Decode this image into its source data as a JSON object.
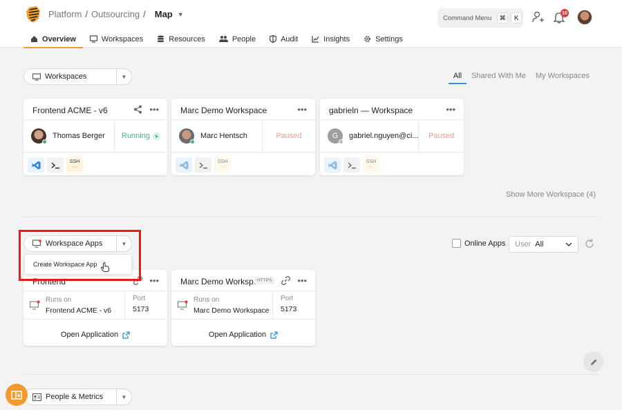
{
  "header": {
    "breadcrumb": [
      "Platform",
      "Outsourcing"
    ],
    "current_page": "Map",
    "command_menu": {
      "label": "Command Menu",
      "key1": "⌘",
      "key2": "K"
    },
    "notification_count": "10"
  },
  "tabs": [
    {
      "label": "Overview",
      "icon": "home-icon",
      "active": true
    },
    {
      "label": "Workspaces",
      "icon": "monitor-icon"
    },
    {
      "label": "Resources",
      "icon": "database-icon"
    },
    {
      "label": "People",
      "icon": "people-icon"
    },
    {
      "label": "Audit",
      "icon": "shield-icon"
    },
    {
      "label": "Insights",
      "icon": "chart-icon"
    },
    {
      "label": "Settings",
      "icon": "gear-icon"
    }
  ],
  "workspaces_section": {
    "selector_label": "Workspaces",
    "filters": [
      "All",
      "Shared With Me",
      "My Workspaces"
    ],
    "active_filter": "All",
    "cards": [
      {
        "title": "Frontend ACME - v6",
        "owner": "Thomas Berger",
        "status": "Running",
        "status_color": "#4caf7d",
        "tools": [
          "vscode-icon",
          "terminal-icon",
          "ssh-icon"
        ]
      },
      {
        "title": "Marc Demo Workspace",
        "owner": "Marc Hentsch",
        "status": "Paused",
        "status_color": "#f0a090",
        "tools": [
          "vscode-icon",
          "terminal-icon",
          "ssh-icon"
        ]
      },
      {
        "title": "gabrieln — Workspace",
        "owner": "gabriel.nguyen@ci...",
        "avatar_letter": "G",
        "status": "Paused",
        "status_color": "#f0a090",
        "tools": [
          "vscode-icon",
          "terminal-icon",
          "ssh-icon"
        ]
      }
    ],
    "ssh_label": "SSH",
    "show_more": "Show More Workspace (4)"
  },
  "apps_section": {
    "selector_label": "Workspace Apps",
    "dropdown_item": "Create Workspace App",
    "online_apps_label": "Online Apps",
    "user_filter": {
      "label": "User",
      "value": "All"
    },
    "cards": [
      {
        "title": "Frontend",
        "runs_on_label": "Runs on",
        "runs_on": "Frontend ACME - v6",
        "port_label": "Port",
        "port": "5173",
        "open_label": "Open Application"
      },
      {
        "title": "Marc Demo Worksp...",
        "badge": "HTTPS",
        "runs_on_label": "Runs on",
        "runs_on": "Marc Demo Workspace",
        "port_label": "Port",
        "port": "5173",
        "open_label": "Open Application"
      }
    ]
  },
  "people_section": {
    "selector_label": "People & Metrics"
  },
  "colors": {
    "accent": "#f29a2e",
    "link": "#3b8bdf",
    "highlight": "#e31c1c"
  }
}
